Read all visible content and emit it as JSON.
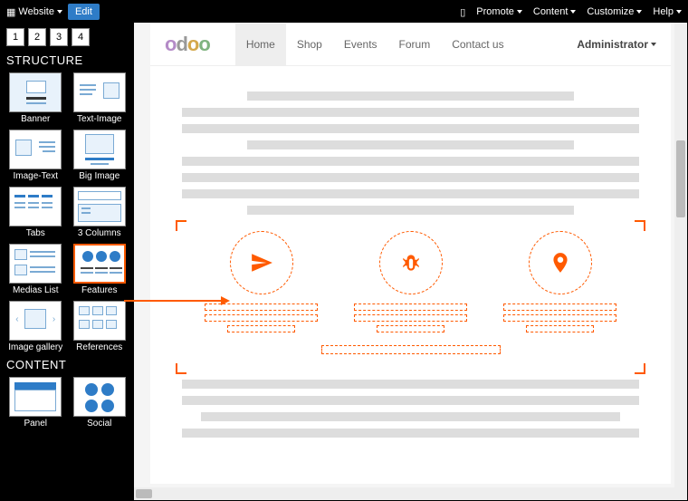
{
  "topbar": {
    "website_label": "Website",
    "edit_label": "Edit",
    "menu": [
      "Promote",
      "Content",
      "Customize",
      "Help"
    ]
  },
  "editor": {
    "pages": [
      "1",
      "2",
      "3",
      "4"
    ],
    "sections": {
      "structure": {
        "title": "STRUCTURE",
        "blocks": [
          {
            "id": "banner",
            "label": "Banner"
          },
          {
            "id": "text-image",
            "label": "Text-Image"
          },
          {
            "id": "image-text",
            "label": "Image-Text"
          },
          {
            "id": "big-image",
            "label": "Big Image"
          },
          {
            "id": "tabs",
            "label": "Tabs"
          },
          {
            "id": "3-columns",
            "label": "3 Columns"
          },
          {
            "id": "medias-list",
            "label": "Medias List"
          },
          {
            "id": "features",
            "label": "Features",
            "selected": true
          },
          {
            "id": "image-gallery",
            "label": "Image gallery"
          },
          {
            "id": "references",
            "label": "References"
          }
        ]
      },
      "content": {
        "title": "CONTENT",
        "blocks": [
          {
            "id": "panel",
            "label": "Panel"
          },
          {
            "id": "social",
            "label": "Social"
          }
        ]
      }
    }
  },
  "site": {
    "logo": "odoo",
    "nav": [
      {
        "label": "Home",
        "active": true
      },
      {
        "label": "Shop"
      },
      {
        "label": "Events"
      },
      {
        "label": "Forum"
      },
      {
        "label": "Contact us"
      }
    ],
    "admin_label": "Administrator"
  },
  "feature_icons": [
    "paper-plane-icon",
    "bug-icon",
    "map-pin-icon"
  ]
}
